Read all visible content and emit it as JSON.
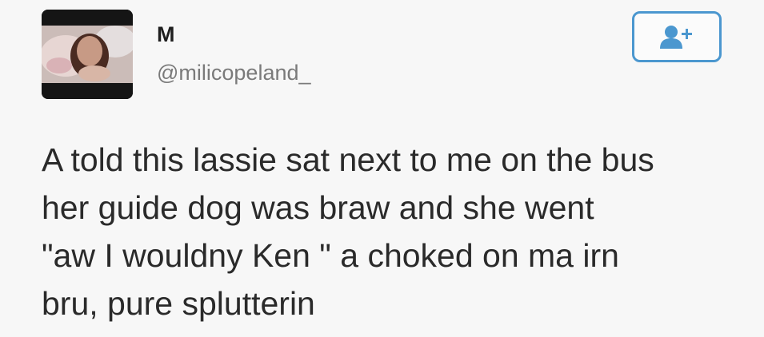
{
  "tweet": {
    "display_name": "M",
    "username": "@milicopeland_",
    "text": "A told this lassie sat next to me on the bus\nher guide dog was braw and she went\n\"aw I wouldny Ken \" a choked on ma irn\nbru, pure splutterin",
    "follow_icon": "add-user-icon",
    "accent_color": "#4b97cf"
  }
}
